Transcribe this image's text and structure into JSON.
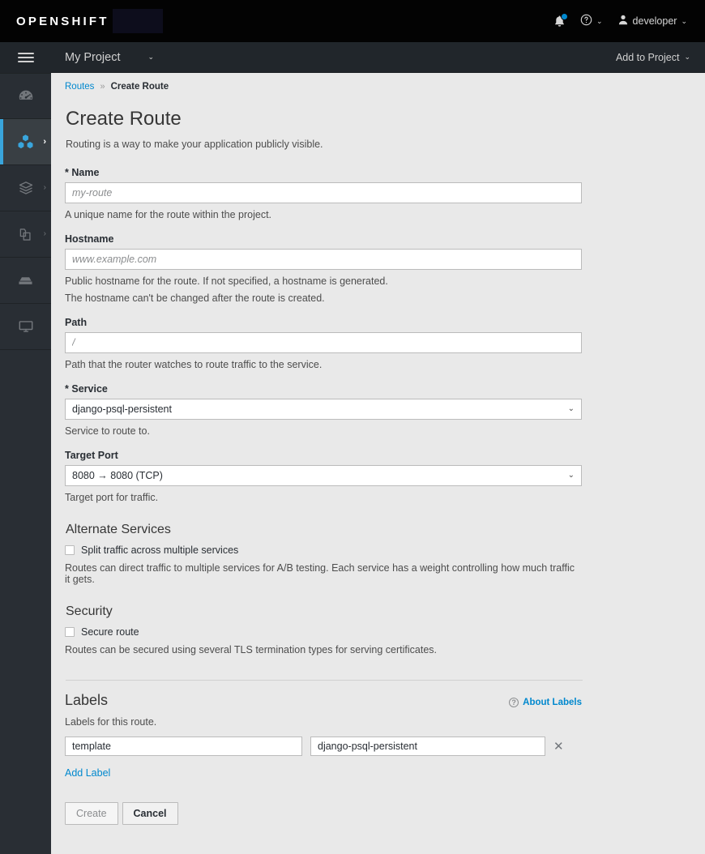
{
  "masthead": {
    "brand": "OPENSHIFT",
    "brand_redacted": true,
    "notifications_icon": "bell-icon",
    "help_icon": "help-circle-icon",
    "user_icon": "user-icon",
    "username": "developer",
    "caret": "⌄"
  },
  "contextbar": {
    "project_name": "My Project",
    "project_caret": "⌄",
    "add_to_project": "Add to Project",
    "add_caret": "⌄"
  },
  "sidebar": {
    "toggle_icon": "hamburger-menu-icon",
    "items": [
      {
        "name": "overview",
        "icon": "gauge-icon",
        "active": false,
        "has_arrow": false
      },
      {
        "name": "applications",
        "icon": "cubes-icon",
        "active": true,
        "has_arrow": true,
        "arrow": "›"
      },
      {
        "name": "builds",
        "icon": "layers-icon",
        "active": false,
        "has_arrow": true,
        "arrow": "›"
      },
      {
        "name": "resources",
        "icon": "files-icon",
        "active": false,
        "has_arrow": true,
        "arrow": "›"
      },
      {
        "name": "storage",
        "icon": "server-icon",
        "active": false,
        "has_arrow": false
      },
      {
        "name": "monitoring",
        "icon": "monitor-icon",
        "active": false,
        "has_arrow": false
      }
    ]
  },
  "breadcrumb": {
    "parent": "Routes",
    "separator": "»",
    "current": "Create Route"
  },
  "page": {
    "title": "Create Route",
    "subtitle": "Routing is a way to make your application publicly visible."
  },
  "form": {
    "name": {
      "star": "*",
      "label": "Name",
      "value": "",
      "placeholder": "my-route",
      "help": "A unique name for the route within the project."
    },
    "hostname": {
      "label": "Hostname",
      "value": "",
      "placeholder": "www.example.com",
      "help": "Public hostname for the route. If not specified, a hostname is generated.",
      "help2": "The hostname can't be changed after the route is created."
    },
    "path": {
      "label": "Path",
      "value": "",
      "placeholder": "/",
      "help": "Path that the router watches to route traffic to the service."
    },
    "service": {
      "star": "*",
      "label": "Service",
      "selected": "django-psql-persistent",
      "options": [
        "django-psql-persistent"
      ],
      "help": "Service to route to.",
      "caret": "⌄"
    },
    "target_port": {
      "label": "Target Port",
      "selected": "8080 → 8080 (TCP)",
      "options": [
        "8080 → 8080 (TCP)"
      ],
      "help": "Target port for traffic.",
      "caret": "⌄"
    },
    "alternate_services": {
      "title": "Alternate Services",
      "checkbox_label": "Split traffic across multiple services",
      "checked": false,
      "help": "Routes can direct traffic to multiple services for A/B testing. Each service has a weight controlling how much traffic it gets."
    },
    "security": {
      "title": "Security",
      "checkbox_label": "Secure route",
      "checked": false,
      "help": "Routes can be secured using several TLS termination types for serving certificates."
    }
  },
  "labels": {
    "title": "Labels",
    "about_icon": "help-circle-icon",
    "about_text": "About Labels",
    "help": "Labels for this route.",
    "rows": [
      {
        "key": "template",
        "value": "django-psql-persistent",
        "remove_icon": "close-icon",
        "remove_glyph": "✕"
      }
    ],
    "add_label": "Add Label"
  },
  "actions": {
    "create": "Create",
    "create_disabled": true,
    "cancel": "Cancel"
  },
  "colors": {
    "accent_blue": "#0088ce",
    "nav_active_blue": "#39a5dc",
    "masthead_bg": "#030303",
    "contextbar_bg": "#21262b",
    "sidebar_bg": "#292e34",
    "page_bg": "#e9e9e9"
  }
}
